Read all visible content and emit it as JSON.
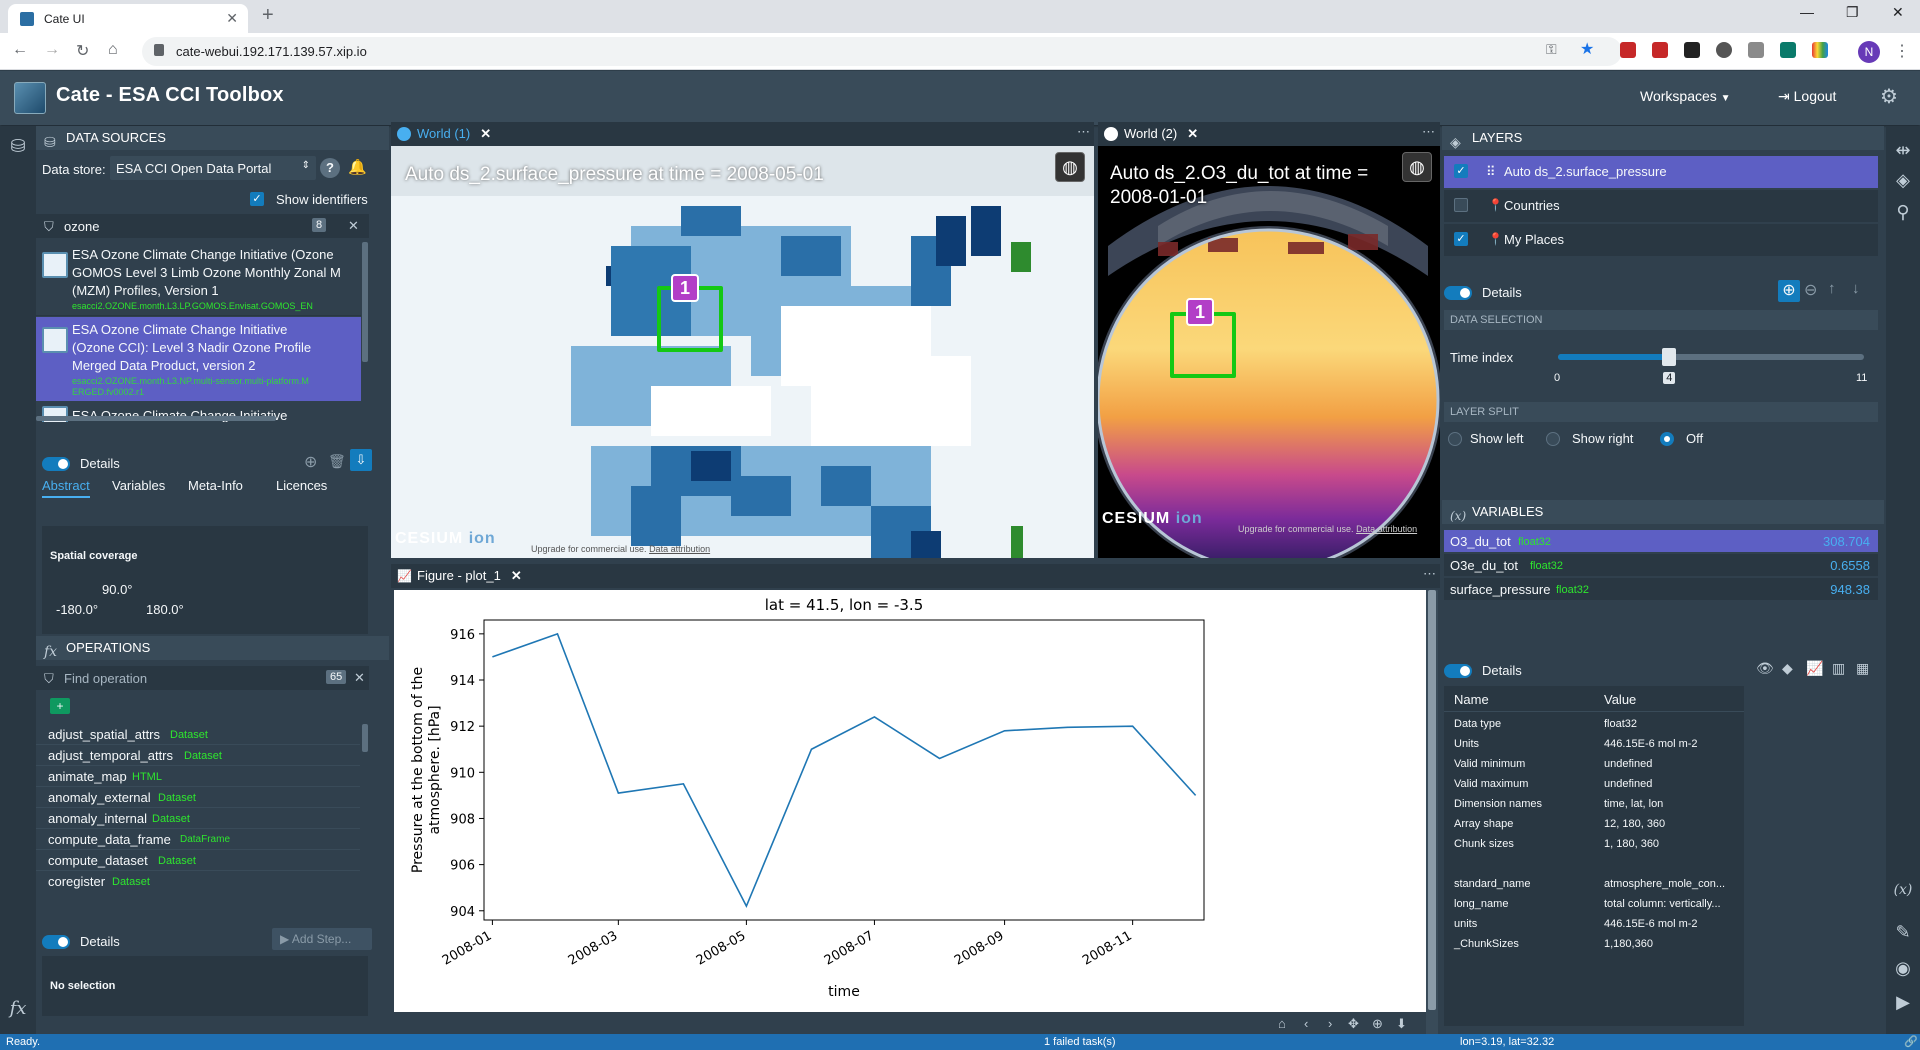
{
  "browser": {
    "tab_title": "Cate UI",
    "url": "cate-webui.192.171.139.57.xip.io",
    "profile_initial": "N"
  },
  "app": {
    "title": "Cate - ESA CCI Toolbox",
    "workspaces_label": "Workspaces",
    "logout_label": "Logout"
  },
  "data_sources": {
    "title": "DATA SOURCES",
    "data_store_label": "Data store:",
    "data_store_value": "ESA CCI Open Data Portal",
    "show_identifiers_label": "Show identifiers",
    "filter_value": "ozone",
    "filter_count": "8",
    "items": [
      {
        "title_lines": [
          "ESA Ozone Climate Change Initiative (Ozone",
          "GOMOS Level 3 Limb Ozone Monthly Zonal M",
          "(MZM) Profiles, Version 1"
        ],
        "id": "esacci2.OZONE.month.L3.LP.GOMOS.Envisat.GOMOS_EN"
      },
      {
        "title_lines": [
          "ESA Ozone Climate Change Initiative",
          "(Ozone CCI): Level 3 Nadir Ozone Profile",
          "Merged Data Product, version 2"
        ],
        "id": "esacci2.OZONE.month.L3.NP.multi-sensor.multi-platform.MERGED.fv0002.r1"
      },
      {
        "title_lines": [
          "ESA Ozone Climate Change Initiative"
        ],
        "id": ""
      }
    ],
    "details_label": "Details",
    "tabs": [
      "Abstract",
      "Variables",
      "Meta-Info",
      "Licences"
    ],
    "spatial_coverage_label": "Spatial coverage",
    "coverage_north": "90.0°",
    "coverage_west": "-180.0°",
    "coverage_east": "180.0°"
  },
  "operations": {
    "title": "OPERATIONS",
    "search_placeholder": "Find operation",
    "count": "65",
    "items": [
      {
        "name": "adjust_spatial_attrs",
        "type": "Dataset"
      },
      {
        "name": "adjust_temporal_attrs",
        "type": "Dataset"
      },
      {
        "name": "animate_map",
        "type": "HTML"
      },
      {
        "name": "anomaly_external",
        "type": "Dataset"
      },
      {
        "name": "anomaly_internal",
        "type": "Dataset"
      },
      {
        "name": "compute_data_frame",
        "type": "DataFrame"
      },
      {
        "name": "compute_dataset",
        "type": "Dataset"
      },
      {
        "name": "coregister",
        "type": "Dataset"
      }
    ],
    "details_label": "Details",
    "add_step_label": "Add Step...",
    "no_selection": "No selection"
  },
  "views": {
    "world1_tab": "World (1)",
    "world2_tab": "World (2)",
    "world1_caption": "Auto ds_2.surface_pressure at time = 2008-05-01",
    "world2_caption_line1": "Auto ds_2.O3_du_tot at time =",
    "world2_caption_line2": "2008-01-01",
    "marker_label": "1",
    "cesium_text": "CESIUM",
    "ion_text": "ion",
    "upgrade_text": "Upgrade for commercial use.",
    "data_attribution": "Data attribution",
    "figure_tab": "Figure - plot_1"
  },
  "layers": {
    "title": "LAYERS",
    "items": [
      {
        "label": "Auto ds_2.surface_pressure",
        "checked": true
      },
      {
        "label": "Countries",
        "checked": false
      },
      {
        "label": "My Places",
        "checked": true
      }
    ],
    "details_label": "Details",
    "data_selection_label": "DATA SELECTION",
    "time_index_label": "Time index",
    "time_min": "0",
    "time_value": "4",
    "time_max": "11",
    "time_fraction": 0.3636,
    "layer_split_label": "LAYER SPLIT",
    "split_options": [
      "Show left",
      "Show right",
      "Off"
    ],
    "split_selected": "Off"
  },
  "variables": {
    "title": "VARIABLES",
    "items": [
      {
        "name": "O3_du_tot",
        "type": "float32",
        "value": "308.704"
      },
      {
        "name": "O3e_du_tot",
        "type": "float32",
        "value": "0.6558"
      },
      {
        "name": "surface_pressure",
        "type": "float32",
        "value": "948.38"
      }
    ],
    "details_label": "Details",
    "table_headers": [
      "Name",
      "Value"
    ],
    "table_rows": [
      [
        "Data type",
        "float32"
      ],
      [
        "Units",
        "446.15E-6 mol m-2"
      ],
      [
        "Valid minimum",
        "undefined"
      ],
      [
        "Valid maximum",
        "undefined"
      ],
      [
        "Dimension names",
        "time, lat, lon"
      ],
      [
        "Array shape",
        "12, 180, 360"
      ],
      [
        "Chunk sizes",
        "1, 180, 360"
      ],
      [
        "",
        ""
      ],
      [
        "standard_name",
        "atmosphere_mole_con..."
      ],
      [
        "long_name",
        "total column: vertically..."
      ],
      [
        "units",
        "446.15E-6 mol m-2"
      ],
      [
        "_ChunkSizes",
        "1,180,360"
      ]
    ]
  },
  "status": {
    "left": "Ready.",
    "center": "1 failed task(s)",
    "right": "lon=3.19, lat=32.32"
  },
  "chart_data": {
    "type": "line",
    "title": "lat = 41.5, lon = -3.5",
    "xlabel": "time",
    "ylabel": "Pressure at the bottom of the atmosphere. [hPa]",
    "x": [
      "2008-01-01",
      "2008-02-01",
      "2008-03-01",
      "2008-04-01",
      "2008-05-01",
      "2008-06-01",
      "2008-07-01",
      "2008-08-01",
      "2008-09-01",
      "2008-10-01",
      "2008-11-01",
      "2008-12-01"
    ],
    "series": [
      {
        "values": [
          915.0,
          916.0,
          909.1,
          909.5,
          904.2,
          911.0,
          912.4,
          910.6,
          911.8,
          911.95,
          912.0,
          909.0
        ]
      }
    ],
    "xticks": [
      "2008-01",
      "2008-03",
      "2008-05",
      "2008-07",
      "2008-09",
      "2008-11"
    ],
    "yticks": [
      904,
      906,
      908,
      910,
      912,
      914,
      916
    ],
    "ylim": [
      903.6,
      916.6
    ],
    "color": "#1f77b4"
  }
}
